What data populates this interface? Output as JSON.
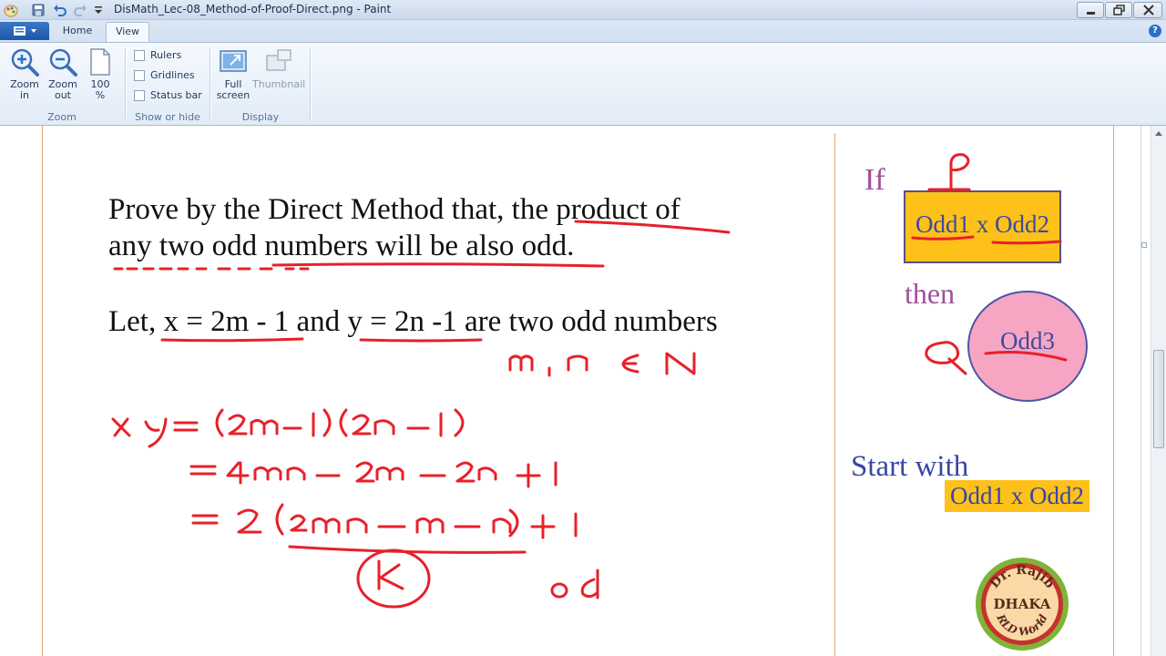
{
  "window": {
    "title": "DisMath_Lec-08_Method-of-Proof-Direct.png - Paint"
  },
  "tabs": {
    "home": "Home",
    "view": "View"
  },
  "help": "?",
  "ribbon": {
    "zoom_in": [
      "Zoom",
      "in"
    ],
    "zoom_out": [
      "Zoom",
      "out"
    ],
    "zoom_100": [
      "100",
      "%"
    ],
    "rulers": "Rulers",
    "gridlines": "Gridlines",
    "status_bar": "Status bar",
    "full_screen": [
      "Full",
      "screen"
    ],
    "thumbnail": "Thumbnail",
    "groups": {
      "zoom": "Zoom",
      "show_or_hide": "Show or hide",
      "display": "Display"
    }
  },
  "slide": {
    "problem_line1": "Prove by the Direct Method that, the product of",
    "problem_line2": "any two odd numbers will be also odd.",
    "let_statement": "Let, x = 2m - 1 and y = 2n -1 are two odd numbers",
    "if_label": "If",
    "odd_product": "Odd1 x Odd2",
    "then_label": "then",
    "odd3": "Odd3",
    "start_label": "Start with",
    "start_box": "Odd1 x Odd2"
  },
  "handwriting": {
    "membership": "m, n ∈ N",
    "step1": "xy = (2m-1)(2n-1)",
    "step2": "= 4mn - 2m - 2n + 1",
    "step3": "= 2(2mn - m - n) + 1",
    "k_label": "k",
    "od_label": "od",
    "p_label": "P",
    "q_label": "Q"
  },
  "logo": {
    "top": "Dr. Rajib",
    "middle": "DHAKA",
    "bottom": "RLD World"
  },
  "colors": {
    "ink": "#e8202a",
    "accent_yellow": "#fdc11a",
    "purple_text": "#a0509c",
    "blue_text": "#3846a4",
    "circle_fill": "#f6a6c2"
  }
}
